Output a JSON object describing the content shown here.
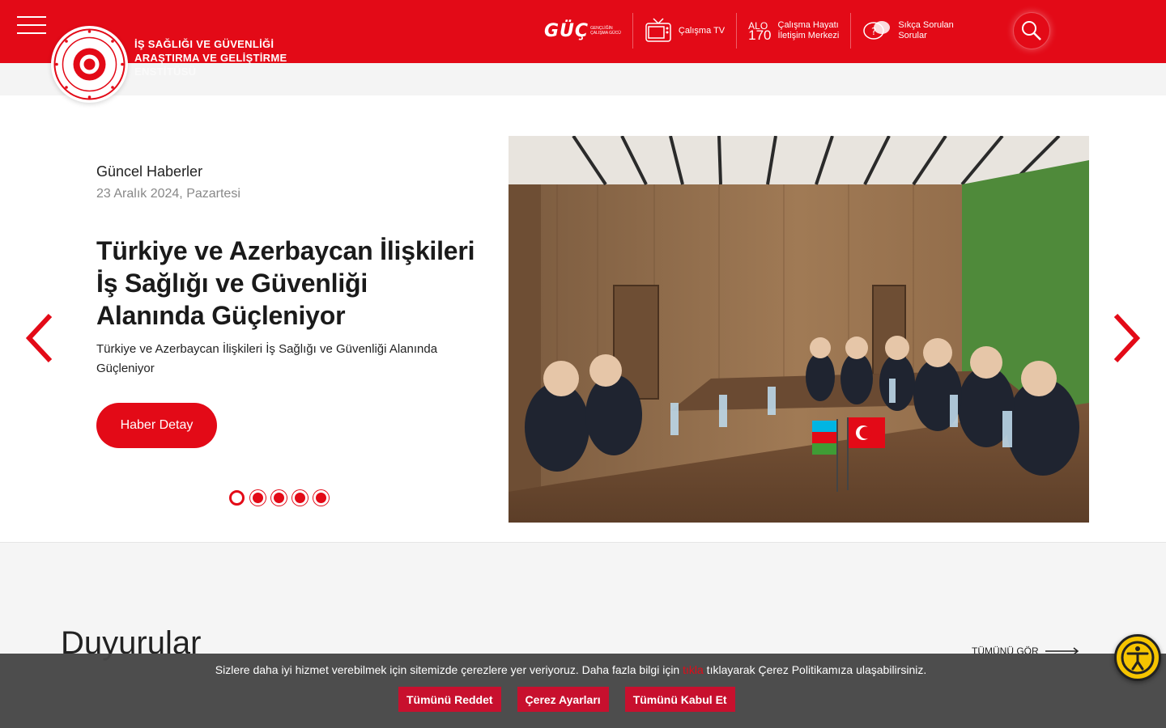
{
  "header": {
    "org_line1": "İŞ SAĞLIĞI VE GÜVENLİĞİ",
    "org_line2": "ARAŞTIRMA VE GELİŞTİRME",
    "org_line3": "ENSTİTÜSÜ",
    "goc_logo": "GÜÇ",
    "goc_sub1": "GENÇLİĞİN",
    "goc_sub2": "ÇALIŞMA GÜCÜ",
    "tv_label": "Çalışma TV",
    "alo_top": "ALO",
    "alo_num": "170",
    "alo_line1": "Çalışma Hayatı",
    "alo_line2": "İletişim Merkezi",
    "faq_line1": "Sıkça Sorulan",
    "faq_line2": "Sorular"
  },
  "slider": {
    "category": "Güncel Haberler",
    "date": "23 Aralık 2024, Pazartesi",
    "title": "Türkiye ve Azerbaycan İlişkileri İş Sağlığı ve Güvenliği Alanında Güçleniyor",
    "summary": "Türkiye ve Azerbaycan İlişkileri İş Sağlığı ve Güvenliği Alanında Güçleniyor",
    "detail_label": "Haber Detay",
    "slide_count": 5,
    "active_slide": 1
  },
  "announcements": {
    "title": "Duyurular",
    "see_all": "TÜMÜNÜ GÖR"
  },
  "cookie": {
    "text_before": "Sizlere daha iyi hizmet verebilmek için sitemizde çerezlere yer veriyoruz.  Daha fazla bilgi için ",
    "link": "tıkla",
    "text_after": " tıklayarak Çerez Politikamıza ulaşabilirsiniz.",
    "reject_all": "Tümünü Reddet",
    "settings": "Çerez Ayarları",
    "accept_all": "Tümünü Kabul Et"
  },
  "colors": {
    "brand_red": "#e30a17",
    "cookie_btn": "#c8102e",
    "a11y_yellow": "#f5c400"
  }
}
